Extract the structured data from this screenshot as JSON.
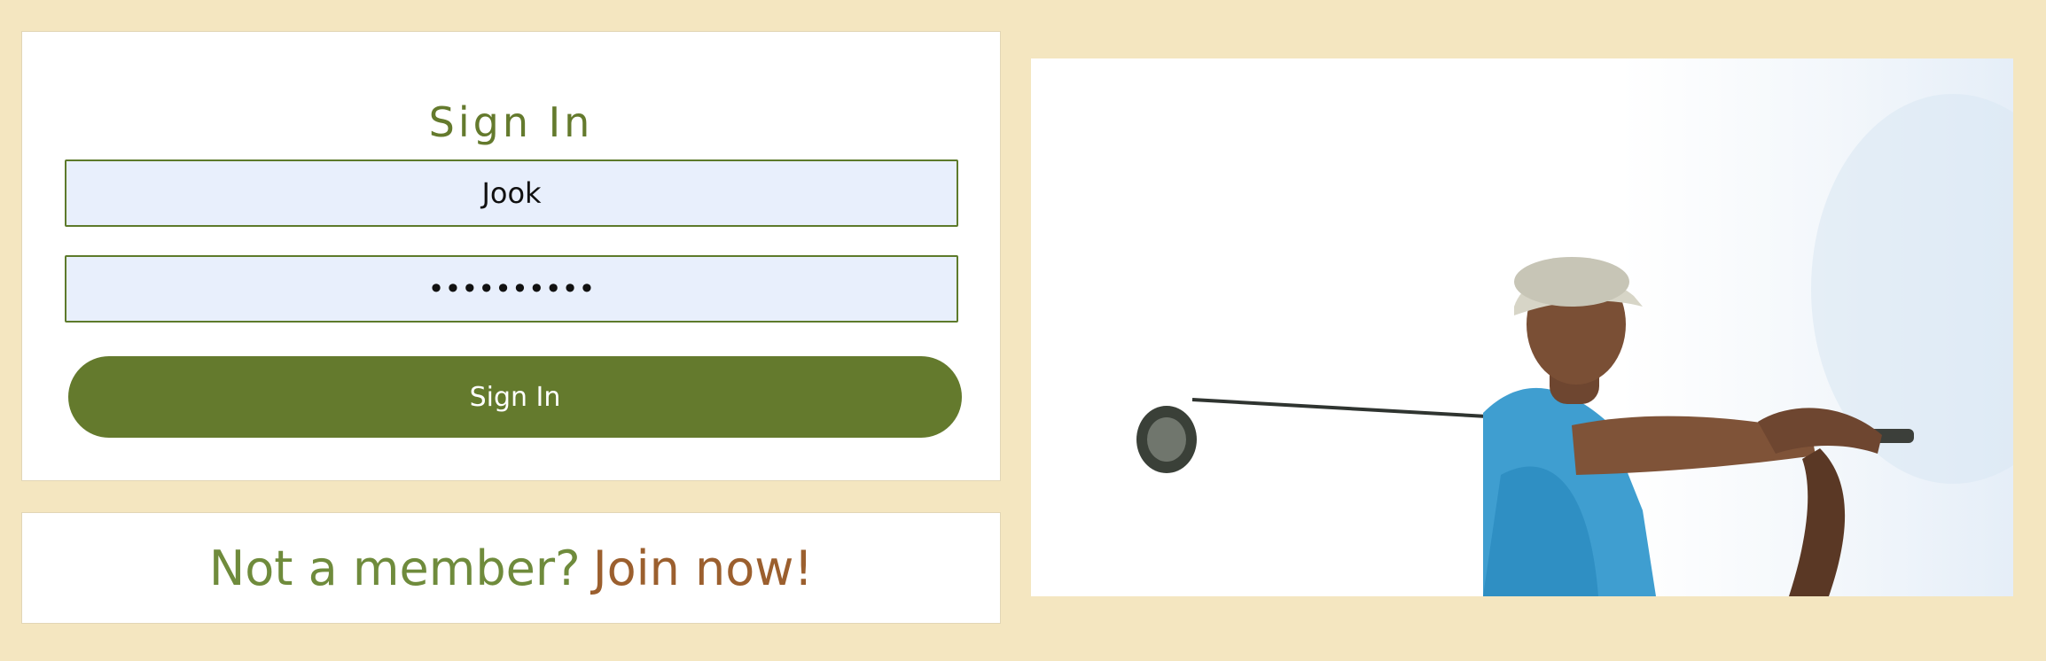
{
  "signin": {
    "title": "Sign In",
    "username_value": "Jook",
    "password_value": "••••••••••",
    "button_label": "Sign In"
  },
  "join": {
    "text": "Not a member?",
    "link": "Join now!"
  },
  "colors": {
    "background": "#f4e6c0",
    "accent_green": "#647a2d",
    "link_brown": "#9b5f2e",
    "input_bg": "#e8effc"
  }
}
